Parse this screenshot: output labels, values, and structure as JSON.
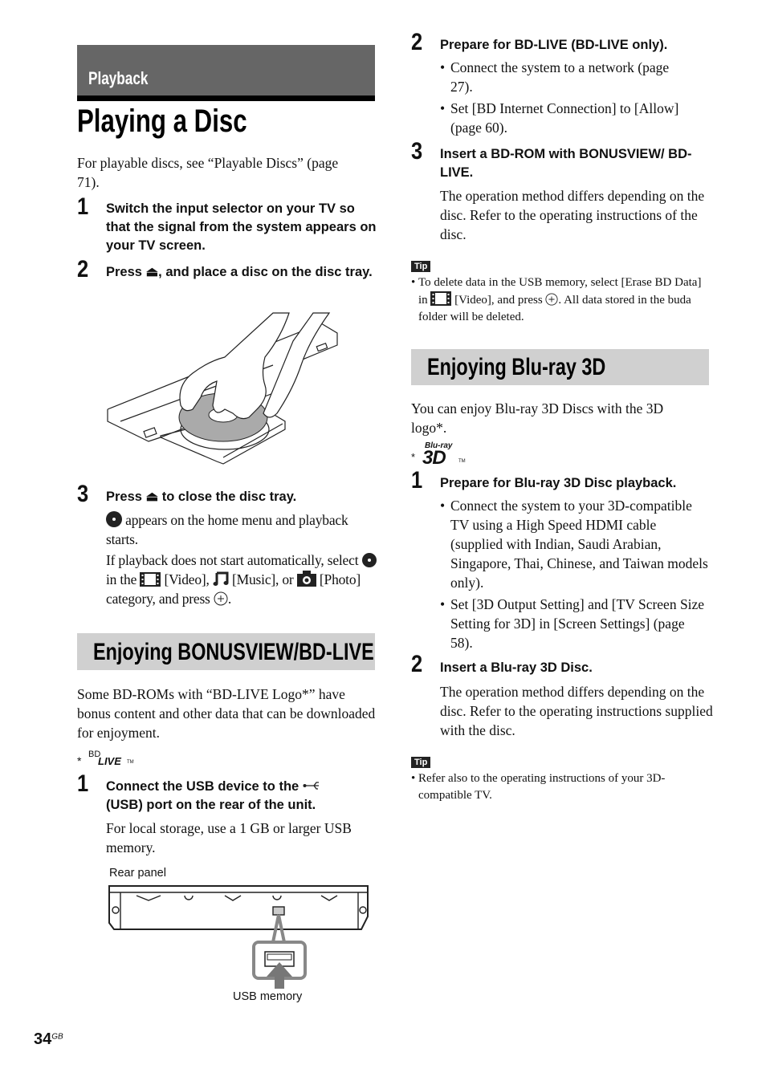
{
  "header": {
    "section_label": "Playback",
    "page_title": "Playing a Disc",
    "section_bar_color": "#666666"
  },
  "left": {
    "intro": "For playable discs, see “Playable Discs” (page 71).",
    "steps": [
      {
        "num": "1",
        "title": "Switch the input selector on your TV so that the signal from the system appears on your TV screen."
      },
      {
        "num": "2",
        "title_pre": "Press",
        "title_post": ", and place a disc on the disc tray."
      },
      {
        "num": "3",
        "title_pre": "Press",
        "title_post": " to close the disc tray.",
        "body1": " appears on the home menu and playback starts.",
        "body2_a": "If playback does not start automatically, select ",
        "body2_b": " in the ",
        "body2_c": " [Video], ",
        "body2_d": " [Music], or ",
        "body2_e": " [Photo] category, and press ",
        "body2_f": "."
      }
    ],
    "illustration_label": "disc-tray-illustration",
    "bonus_heading": "Enjoying BONUSVIEW/BD-LIVE",
    "bonus_intro": "Some BD-ROMs with “BD-LIVE Logo*” have bonus content and other data that can be downloaded for enjoyment.",
    "bdlive_logo": {
      "asterisk": "*",
      "bd": "BD",
      "live": "LIVE",
      "tm": "TM"
    },
    "usb_step": {
      "num": "1",
      "title_a": "Connect the USB device to the ",
      "title_b": "(USB) port on the rear of the unit.",
      "body": "For local storage, use a 1 GB or larger USB memory."
    },
    "rear_panel_label": "Rear panel",
    "usb_memory_label": "USB memory"
  },
  "right": {
    "steps": [
      {
        "num": "2",
        "title": "Prepare for BD-LIVE (BD-LIVE only).",
        "bullets": [
          "Connect the system to a network (page 27).",
          "Set [BD Internet Connection] to [Allow] (page 60)."
        ]
      },
      {
        "num": "3",
        "title": "Insert a BD-ROM with BONUSVIEW/ BD-LIVE.",
        "body": "The operation method differs depending on the disc. Refer to the operating instructions of the disc."
      }
    ],
    "tip1": {
      "badge": "Tip",
      "text_a": "To delete data in the USB memory, select [Erase BD Data] in ",
      "text_b": " [Video], and press ",
      "text_c": ". All data stored in the buda folder will be deleted."
    },
    "bluray_heading": "Enjoying Blu-ray 3D",
    "bluray_intro": "You can enjoy Blu-ray 3D Discs with the 3D logo*.",
    "bluray_logo": {
      "asterisk": "*",
      "top": "Blu-ray",
      "main": "3D",
      "tm": "TM"
    },
    "bluray_steps": [
      {
        "num": "1",
        "title": "Prepare for Blu-ray 3D Disc playback.",
        "bullets": [
          "Connect the system to your 3D-compatible TV using a High Speed HDMI cable (supplied with Indian, Saudi Arabian, Singapore, Thai, Chinese, and Taiwan models only).",
          "Set [3D Output Setting] and [TV Screen Size Setting for 3D] in [Screen Settings] (page 58)."
        ]
      },
      {
        "num": "2",
        "title": "Insert a Blu-ray 3D Disc.",
        "body": "The operation method differs depending on the disc. Refer to the operating instructions supplied with the disc."
      }
    ],
    "tip2": {
      "badge": "Tip",
      "text": "Refer also to the operating instructions of your 3D-compatible TV."
    }
  },
  "footer": {
    "page_number": "34",
    "page_suffix": "GB"
  }
}
